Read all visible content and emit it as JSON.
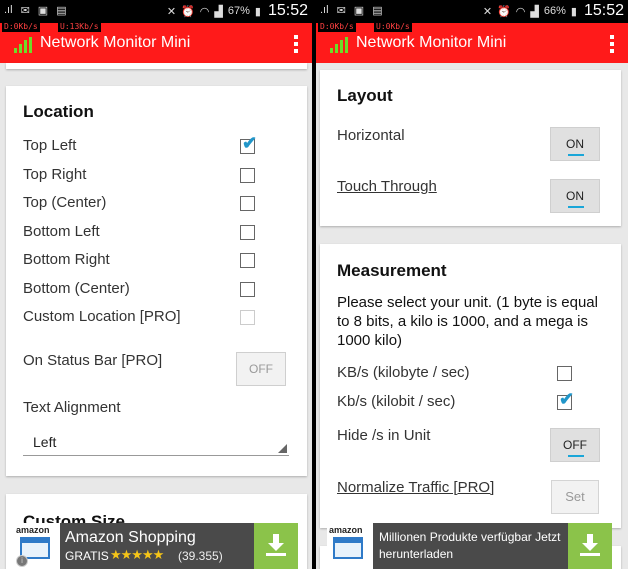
{
  "colors": {
    "appbar": "#ff1a1a",
    "accent": "#1aa6d8",
    "signal": "#6fdc28",
    "ad_download": "#8bc34a"
  },
  "left": {
    "status": {
      "time": "15:52",
      "battery": "67%",
      "upload": "U:13Kb/s",
      "download": "D:0Kb/s"
    },
    "app_title": "Network Monitor Mini",
    "location": {
      "heading": "Location",
      "options": [
        {
          "label": "Top Left",
          "checked": true,
          "enabled": true
        },
        {
          "label": "Top Right",
          "checked": false,
          "enabled": true
        },
        {
          "label": "Top (Center)",
          "checked": false,
          "enabled": true
        },
        {
          "label": "Bottom Left",
          "checked": false,
          "enabled": true
        },
        {
          "label": "Bottom Right",
          "checked": false,
          "enabled": true
        },
        {
          "label": "Bottom (Center)",
          "checked": false,
          "enabled": true
        },
        {
          "label": "Custom Location [PRO]",
          "checked": false,
          "enabled": false
        }
      ],
      "status_bar_label": "On Status Bar [PRO]",
      "status_bar_toggle": "OFF",
      "alignment_label": "Text Alignment",
      "alignment_value": "Left"
    },
    "custom_size_heading": "Custom Size",
    "ad": {
      "title": "Amazon Shopping",
      "price": "GRATIS",
      "stars": "★★★★★",
      "count": "(39.355)",
      "logo_text": "amazon"
    }
  },
  "right": {
    "status": {
      "time": "15:52",
      "battery": "66%",
      "upload": "U:0Kb/s",
      "download": "D:0Kb/s"
    },
    "app_title": "Network Monitor Mini",
    "layout": {
      "heading": "Layout",
      "horizontal_label": "Horizontal",
      "horizontal_toggle": "ON",
      "touch_label": "Touch Through",
      "touch_toggle": "ON"
    },
    "measurement": {
      "heading": "Measurement",
      "description": "Please select your unit. (1 byte is equal to 8 bits, a kilo is 1000, and a mega is 1000 kilo)",
      "units": [
        {
          "label": "KB/s (kilobyte / sec)",
          "checked": false
        },
        {
          "label": "Kb/s (kilobit / sec)",
          "checked": true
        }
      ],
      "hide_label": "Hide /s in Unit",
      "hide_toggle": "OFF",
      "normalize_label": "Normalize Traffic [PRO]",
      "set_button": "Set"
    },
    "ad": {
      "message": "Millionen Produkte verfügbar Jetzt herunterladen",
      "logo_text": "amazon"
    }
  }
}
